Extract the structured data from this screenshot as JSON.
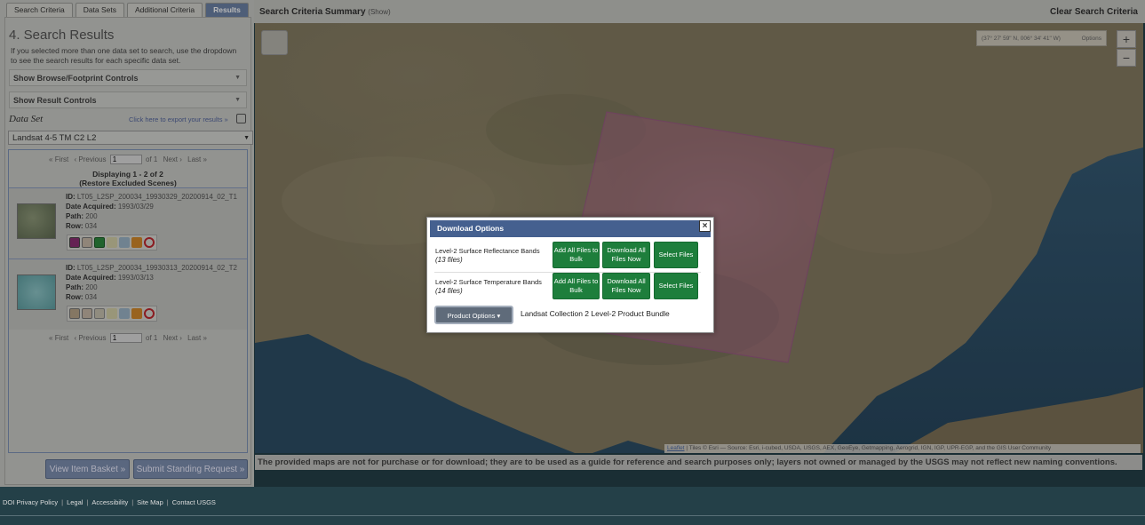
{
  "tabs": [
    "Search Criteria",
    "Data Sets",
    "Additional Criteria",
    "Results"
  ],
  "results": {
    "title": "4. Search Results",
    "description": "If you selected more than one data set to search, use the dropdown to see the search results for each specific data set.",
    "browse_controls": "Show Browse/Footprint Controls",
    "result_controls": "Show Result Controls",
    "dataset_label": "Data Set",
    "export_link": "Click here to export your results »",
    "dataset_selected": "Landsat 4-5 TM C2 L2",
    "pager": {
      "first": "« First",
      "previous": "‹ Previous",
      "page": "1",
      "of": "of 1",
      "next": "Next ›",
      "last": "Last »"
    },
    "displaying": "Displaying 1 - 2 of 2",
    "restore": "(Restore Excluded Scenes)",
    "labels": {
      "id": "ID:",
      "date": "Date Acquired:",
      "path": "Path:",
      "row": "Row:"
    },
    "items": [
      {
        "id": "LT05_L2SP_200034_19930329_20200914_02_T1",
        "date": "1993/03/29",
        "path": "200",
        "row": "034",
        "thumb_color": "#7f8a6e"
      },
      {
        "id": "LT05_L2SP_200034_19930313_20200914_02_T2",
        "date": "1993/03/13",
        "path": "200",
        "row": "034",
        "thumb_color": "#7db6b8"
      }
    ],
    "view_basket": "View Item Basket »",
    "standing_request": "Submit Standing Request »"
  },
  "topbar": {
    "summary": "Search Criteria Summary",
    "show": "(Show)",
    "clear": "Clear Search Criteria"
  },
  "map": {
    "coords": "(37° 27' 59\" N, 006° 34' 41\" W)",
    "coords_options": "Options",
    "zoom_in": "+",
    "zoom_out": "−",
    "attribution_link": "Leaflet",
    "attribution_text": " | Tiles © Esri — Source: Esri, i-cubed, USDA, USGS, AEX, GeoEye, Getmapping, Aerogrid, IGN, IGP, UPR-EGP, and the GIS User Community"
  },
  "disclaimer": "The provided maps are not for purchase or for download; they are to be used as a guide for reference and search purposes only; layers not owned or managed by the USGS may not reflect new naming conventions.",
  "modal": {
    "title": "Download Options",
    "close": "×",
    "rows": [
      {
        "name": "Level-2 Surface Reflectance Bands",
        "files": "(13 files)"
      },
      {
        "name": "Level-2 Surface Temperature Bands",
        "files": "(14 files)"
      }
    ],
    "add_bulk": "Add All Files to Bulk",
    "download_all": "Download All Files Now",
    "select_files": "Select Files",
    "product_options": "Product Options",
    "bundle": "Landsat Collection 2 Level-2 Product Bundle"
  },
  "footer": [
    "DOI Privacy Policy",
    "Legal",
    "Accessibility",
    "Site Map",
    "Contact USGS"
  ]
}
